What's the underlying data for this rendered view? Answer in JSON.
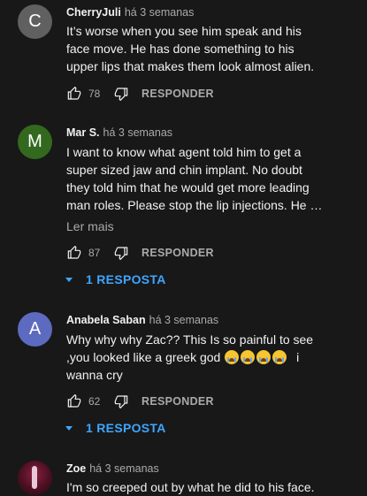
{
  "comments": [
    {
      "avatar_letter": "C",
      "avatar_color": "#606060",
      "author": "CherryJuli",
      "time": "há 3 semanas",
      "lines": [
        "It’s worse when you see him speak and his",
        "face move. He has done something to his",
        "upper lips that makes them look almost alien."
      ],
      "likes": "78",
      "reply_label": "RESPONDER"
    },
    {
      "avatar_letter": "M",
      "avatar_color": "#33691e",
      "author": "Mar S.",
      "time": "há 3 semanas",
      "lines": [
        "I want to know what agent told him to get a",
        "super sized jaw and chin implant. No doubt",
        "they told him that he would get more leading",
        "man roles. Please stop the lip injections. He …"
      ],
      "read_more": "Ler mais",
      "likes": "87",
      "reply_label": "RESPONDER",
      "replies_label": "1 RESPOSTA"
    },
    {
      "avatar_letter": "A",
      "avatar_color": "#5c6bc0",
      "author": "Anabela Saban",
      "time": "há 3 semanas",
      "lines": [
        "Why why why Zac?? This Is so painful to see",
        ",you looked like a greek god",
        "wanna cry"
      ],
      "line2_tail": "i",
      "emoji_name": "loudly-crying-face",
      "likes": "62",
      "reply_label": "RESPONDER",
      "replies_label": "1 RESPOSTA"
    },
    {
      "author": "Zoe",
      "time": "há 3 semanas",
      "lines": [
        "I'm so creeped out by what he did to his face."
      ]
    }
  ],
  "icons": {
    "like": "thumbs-up-icon",
    "dislike": "thumbs-down-icon",
    "expand": "caret-down-icon"
  },
  "colors": {
    "background": "#181818",
    "text": "#f1f1f1",
    "secondary": "#aaaaaa",
    "link": "#3ea6ff"
  }
}
